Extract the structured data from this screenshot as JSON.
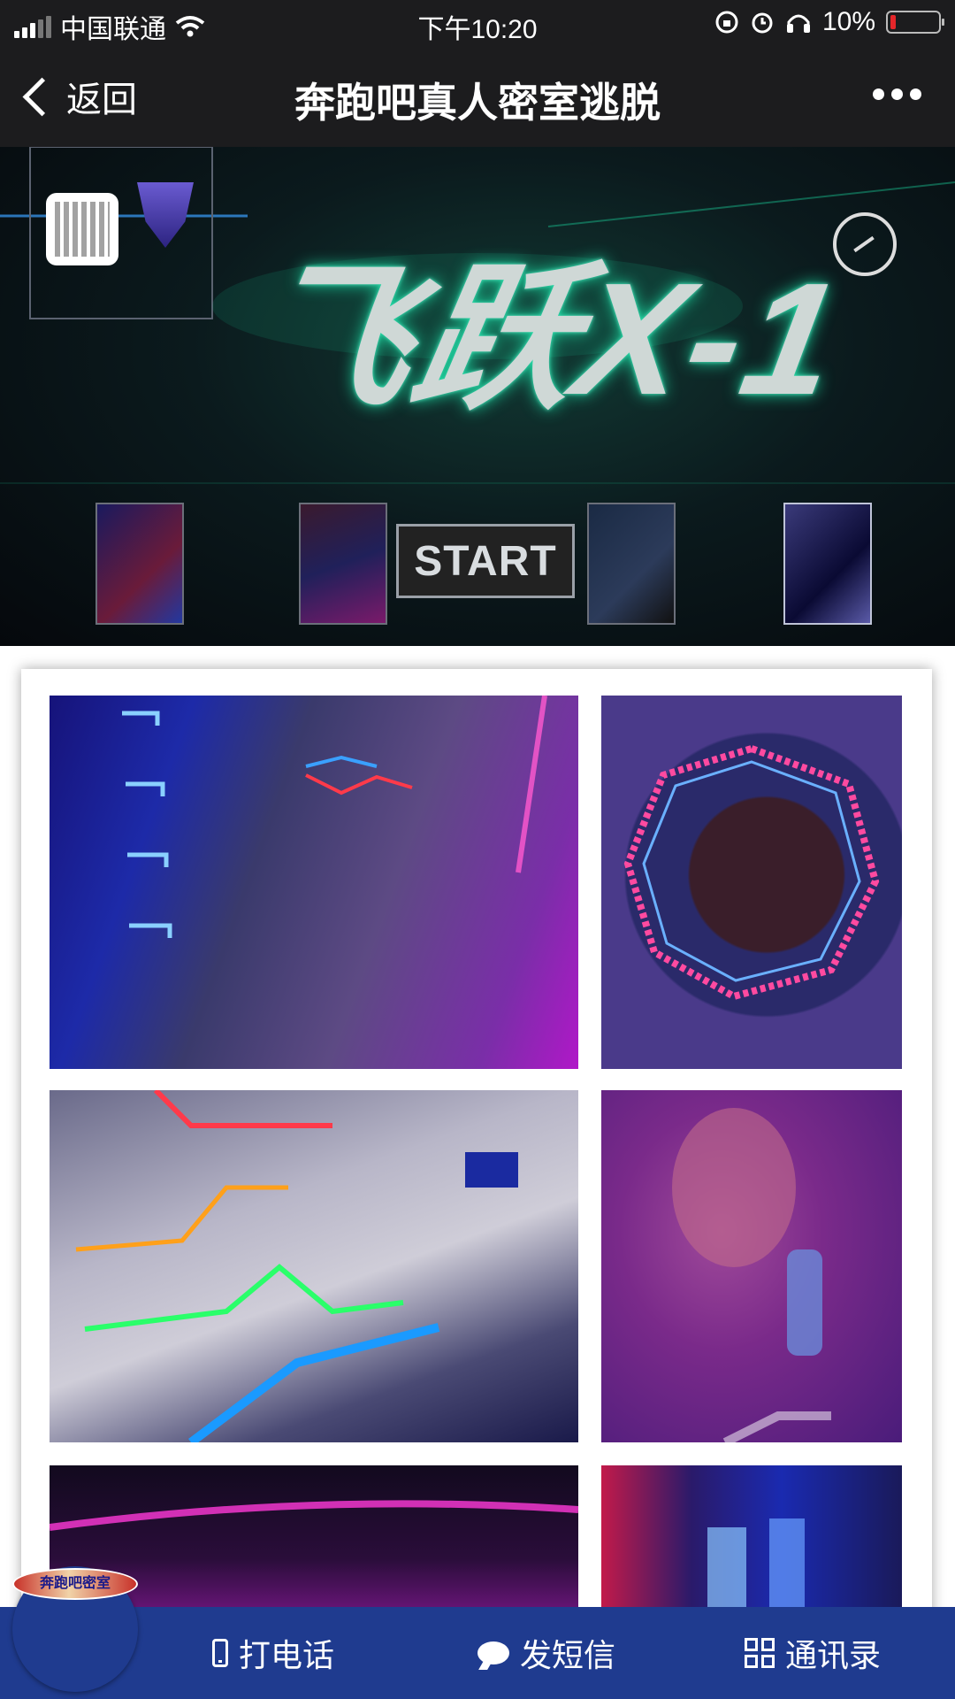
{
  "status_bar": {
    "carrier": "中国联通",
    "time": "下午10:20",
    "battery_percent": "10%",
    "icons": [
      "signal-icon",
      "wifi-icon",
      "rotation-lock-icon",
      "alarm-icon",
      "headphones-icon",
      "battery-icon"
    ],
    "battery_color": "#e5262a",
    "battery_level": 0.1
  },
  "nav": {
    "back_label": "返回",
    "title": "奔跑吧真人密室逃脱",
    "more_icon": "more-dots-icon"
  },
  "banner": {
    "logo_text": "飞跃X-1",
    "start_label": "START",
    "icons": [
      "qr-code-icon",
      "decepticon-emblem-icon",
      "share-icon"
    ]
  },
  "gallery": {
    "photos": [
      "room-photo-1",
      "room-photo-2",
      "room-photo-3",
      "room-photo-4",
      "room-photo-5",
      "room-photo-6"
    ]
  },
  "bottom_bar": {
    "call_label": "打电话",
    "sms_label": "发短信",
    "contacts_label": "通讯录",
    "background": "#1f3b8f"
  },
  "fab": {
    "logo_text": "奔跑吧密室"
  }
}
